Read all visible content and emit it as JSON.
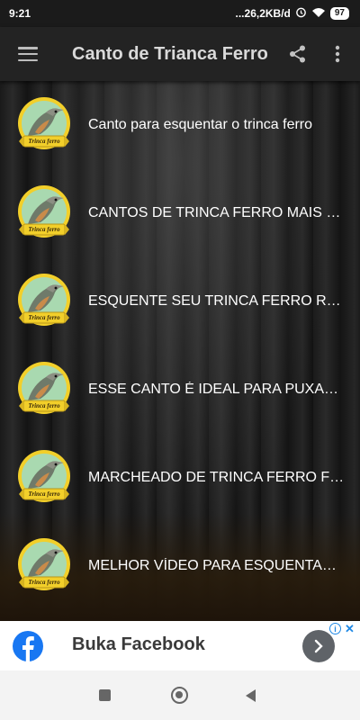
{
  "status_bar": {
    "time": "9:21",
    "network_speed": "...26,2KB/d",
    "battery": "97",
    "icons": [
      "alarm-icon",
      "wifi-icon",
      "battery-icon"
    ]
  },
  "app_bar": {
    "title": "Canto de Trianca Ferro",
    "icons": [
      "menu-icon",
      "share-icon",
      "more-vert-icon"
    ]
  },
  "list": {
    "items": [
      {
        "label": "Canto para esquentar o trinca ferro"
      },
      {
        "label": "CANTOS DE TRINCA FERRO MAIS ESQUENTADOS"
      },
      {
        "label": "ESQUENTE SEU TRINCA FERRO RAPIDO"
      },
      {
        "label": "ESSE CANTO É IDEAL PARA PUXAR O CANTO"
      },
      {
        "label": "MARCHEADO DE TRINCA FERRO FIBRADO"
      },
      {
        "label": "MELHOR VÍDEO PARA ESQUENTAR TRINCA FERRO"
      }
    ],
    "thumbnail_label": "Trinca ferro"
  },
  "ad": {
    "title": "Buka Facebook",
    "info": "i",
    "close": "✕",
    "icons": [
      "facebook-logo-icon",
      "chevron-right-icon",
      "info-icon",
      "close-icon"
    ]
  },
  "nav_bar": {
    "icons": [
      "recents-icon",
      "home-icon",
      "back-icon"
    ]
  },
  "colors": {
    "app_bar": "#232323",
    "title_text": "#d9d9d9",
    "facebook_blue": "#1877f2",
    "badge_yellow": "#f2cf2a"
  }
}
